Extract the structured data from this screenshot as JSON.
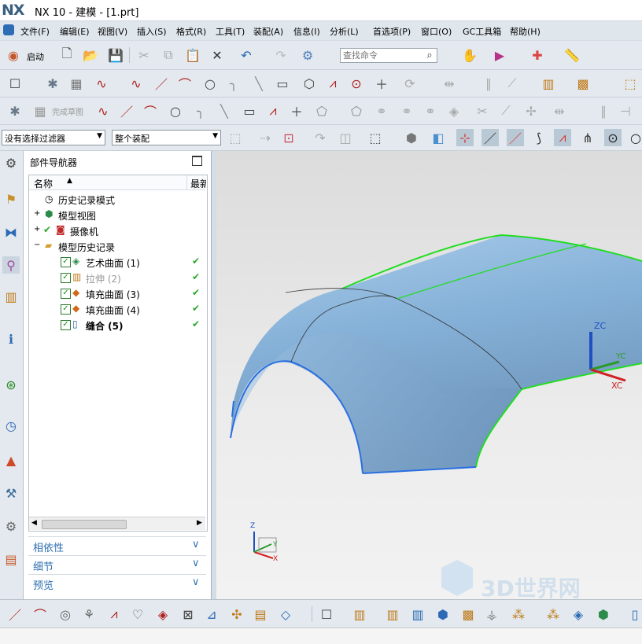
{
  "app": {
    "logo": "NX",
    "title": "NX 10 - 建模 - [1.prt]"
  },
  "menu": [
    "文件(F)",
    "编辑(E)",
    "视图(V)",
    "插入(S)",
    "格式(R)",
    "工具(T)",
    "装配(A)",
    "信息(I)",
    "分析(L)",
    "首选项(P)",
    "窗口(O)",
    "GC工具箱",
    "帮助(H)"
  ],
  "toolbar": {
    "start_label": "启动",
    "search_placeholder": "查找命令",
    "finish_sketch_label": "完成草图"
  },
  "filters": {
    "selection_filter": "没有选择过滤器",
    "assembly_scope": "整个装配"
  },
  "navigator": {
    "title": "部件导航器",
    "col_name": "名称",
    "col_latest": "最新",
    "items": [
      {
        "label": "历史记录模式",
        "icon": "clock-icon"
      },
      {
        "label": "模型视图",
        "icon": "model-views-icon"
      },
      {
        "label": "摄像机",
        "icon": "camera-icon"
      },
      {
        "label": "模型历史记录",
        "icon": "folder-icon"
      },
      {
        "label": "艺术曲面 (1)",
        "icon": "studio-surface-icon",
        "latest": "✔"
      },
      {
        "label": "拉伸 (2)",
        "icon": "extrude-icon",
        "latest": "✔"
      },
      {
        "label": "填充曲面 (3)",
        "icon": "fill-surface-icon",
        "latest": "✔"
      },
      {
        "label": "填充曲面 (4)",
        "icon": "fill-surface-icon",
        "latest": "✔"
      },
      {
        "label": "缝合 (5)",
        "icon": "sew-icon",
        "latest": "✔"
      }
    ],
    "panels": [
      "相依性",
      "细节",
      "预览"
    ]
  },
  "viewport": {
    "triad": {
      "zc": "ZC",
      "yc": "YC",
      "xc": "XC"
    },
    "mini_triad": {
      "z": "Z",
      "y": "Y",
      "x": "X"
    },
    "watermark": "3D世界网"
  },
  "colors": {
    "accent": "#2e6fb0",
    "surface": "#8fb8dc",
    "edge_green": "#22dd22",
    "edge_blue": "#2a6fe0"
  }
}
